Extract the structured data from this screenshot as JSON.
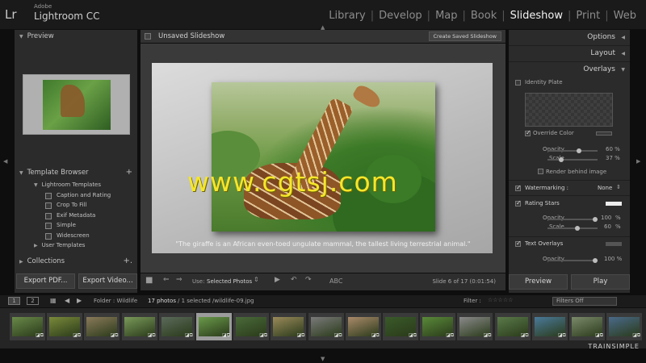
{
  "app": {
    "brand_small": "Adobe",
    "brand_name": "Lightroom CC",
    "logo": "Lr"
  },
  "modules": [
    {
      "label": "Library",
      "active": false
    },
    {
      "label": "Develop",
      "active": false
    },
    {
      "label": "Map",
      "active": false
    },
    {
      "label": "Book",
      "active": false
    },
    {
      "label": "Slideshow",
      "active": true
    },
    {
      "label": "Print",
      "active": false
    },
    {
      "label": "Web",
      "active": false
    }
  ],
  "left_panel": {
    "preview_header": "Preview",
    "template_browser_header": "Template Browser",
    "template_browser_add": "+",
    "templates": {
      "folder": "Lightroom Templates",
      "items": [
        "Caption and Rating",
        "Crop To Fill",
        "Exif Metadata",
        "Simple",
        "Widescreen"
      ],
      "user_folder": "User Templates"
    },
    "collections_header": "Collections",
    "collections_add": "+.",
    "export_pdf": "Export PDF...",
    "export_video": "Export Video..."
  },
  "center": {
    "title": "Unsaved Slideshow",
    "create_saved": "Create Saved Slideshow",
    "caption": "\"The giraffe is an African even-toed ungulate mammal, the tallest living terrestrial animal.\"",
    "watermark_text": "www.cgtsj.com",
    "toolbar": {
      "use_label": "Use:",
      "use_value": "Selected Photos",
      "abc": "ABC",
      "slide_count": "Slide 6 of 17 (0:01:54)"
    }
  },
  "right_panel": {
    "options": "Options",
    "layout": "Layout",
    "overlays": "Overlays",
    "identity_plate": "Identity Plate",
    "override_color": "Override Color",
    "opacity_label": "Opacity",
    "opacity_value": "60 %",
    "scale_label": "Scale",
    "scale_value": "37 %",
    "render_behind": "Render behind image",
    "watermarking": "Watermarking :",
    "watermarking_value": "None",
    "rating_stars": "Rating Stars",
    "rs_opacity_value": "100",
    "rs_scale_value": "60",
    "rs_unit": "%",
    "text_overlays": "Text Overlays",
    "to_opacity_value": "100 %",
    "preview_btn": "Preview",
    "play_btn": "Play"
  },
  "filmstrip": {
    "page1": "1",
    "page2": "2",
    "folder": "Folder : Wildlife",
    "count": "17 photos",
    "selection": "/ 1 selected /wildlife-09.jpg",
    "filter_label": "Filter :",
    "filter_value": "Filters Off",
    "thumb_colors": [
      "#6a8a4a",
      "#7a8a3a",
      "#8a7a5a",
      "#7a9a5a",
      "#5a6a5a",
      "#6a9a4a",
      "#4a6a3a",
      "#9a8a5a",
      "#7a7a7a",
      "#aa8a6a",
      "#3a5a2a",
      "#5a8a3a",
      "#8a8a8a",
      "#5a7a4a",
      "#4a7a9a",
      "#7a8a6a",
      "#4a6a8a"
    ],
    "badge": "◪⧉",
    "watermark_brand": "TRAINSIMPLE"
  }
}
